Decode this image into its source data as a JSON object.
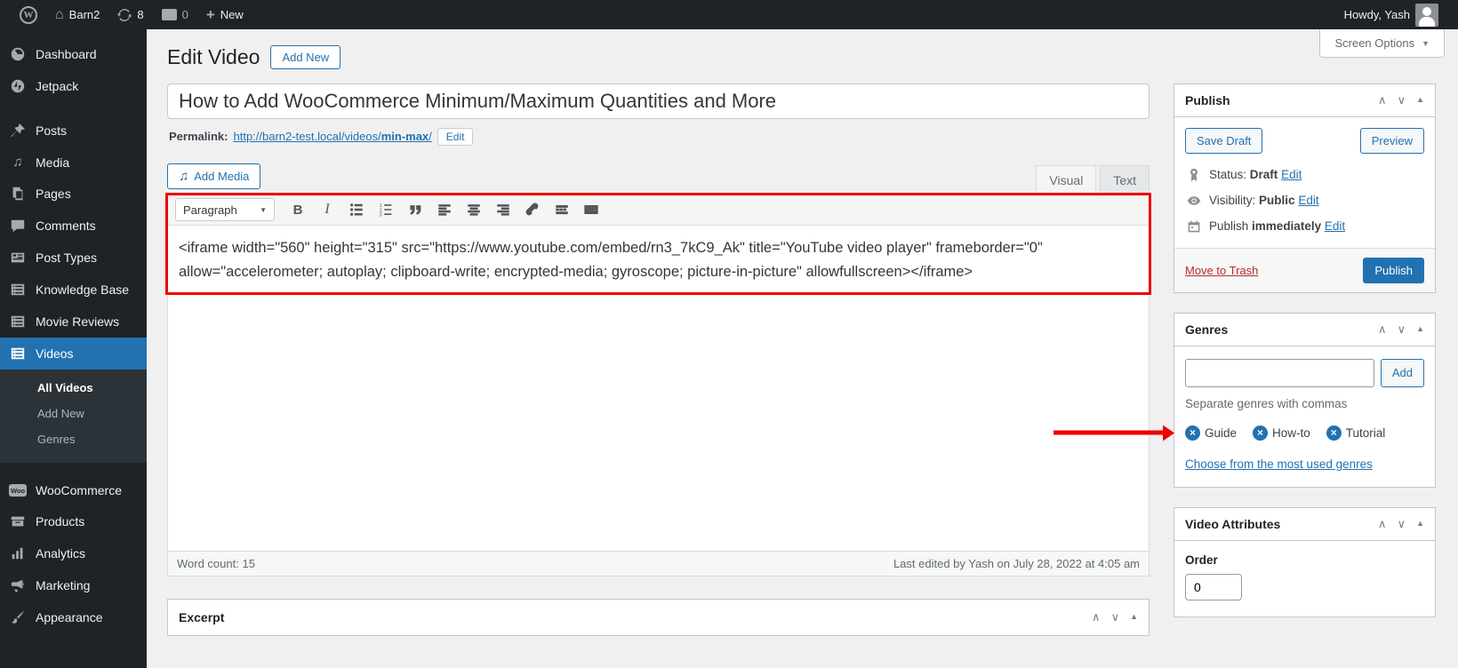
{
  "admin_bar": {
    "site_name": "Barn2",
    "update_count": "8",
    "comment_count": "0",
    "new_label": "New",
    "howdy": "Howdy, Yash"
  },
  "sidebar": {
    "items": [
      {
        "label": "Dashboard"
      },
      {
        "label": "Jetpack"
      },
      {
        "label": "Posts"
      },
      {
        "label": "Media"
      },
      {
        "label": "Pages"
      },
      {
        "label": "Comments"
      },
      {
        "label": "Post Types"
      },
      {
        "label": "Knowledge Base"
      },
      {
        "label": "Movie Reviews"
      },
      {
        "label": "Videos",
        "active": true
      },
      {
        "label": "WooCommerce"
      },
      {
        "label": "Products"
      },
      {
        "label": "Analytics"
      },
      {
        "label": "Marketing"
      },
      {
        "label": "Appearance"
      }
    ],
    "videos_submenu": [
      {
        "label": "All Videos",
        "current": true
      },
      {
        "label": "Add New"
      },
      {
        "label": "Genres"
      }
    ]
  },
  "header": {
    "page_title": "Edit Video",
    "add_new_label": "Add New",
    "screen_options_label": "Screen Options"
  },
  "post": {
    "title_value": "How to Add WooCommerce Minimum/Maximum Quantities and More",
    "permalink_label": "Permalink:",
    "permalink_base": "http://barn2-test.local/videos/",
    "permalink_slug": "min-max",
    "permalink_slash": "/",
    "edit_button": "Edit"
  },
  "editor": {
    "add_media_label": "Add Media",
    "visual_tab": "Visual",
    "text_tab": "Text",
    "format_select": "Paragraph",
    "bold_label": "B",
    "italic_label": "I",
    "content": "<iframe width=\"560\" height=\"315\" src=\"https://www.youtube.com/embed/rn3_7kC9_Ak\" title=\"YouTube video player\" frameborder=\"0\" allow=\"accelerometer; autoplay; clipboard-write; encrypted-media; gyroscope; picture-in-picture\" allowfullscreen></iframe>",
    "word_count_label": "Word count:",
    "word_count_value": "15",
    "last_edited": "Last edited by Yash on July 28, 2022 at 4:05 am"
  },
  "excerpt_panel": {
    "title": "Excerpt"
  },
  "publish_panel": {
    "title": "Publish",
    "save_draft_label": "Save Draft",
    "preview_label": "Preview",
    "status_label": "Status:",
    "status_value": "Draft",
    "visibility_label": "Visibility:",
    "visibility_value": "Public",
    "schedule_label": "Publish",
    "schedule_value": "immediately",
    "edit_link": "Edit",
    "move_to_trash_label": "Move to Trash",
    "publish_button_label": "Publish"
  },
  "genres_panel": {
    "title": "Genres",
    "input_value": "",
    "add_button_label": "Add",
    "hint": "Separate genres with commas",
    "tags": [
      {
        "label": "Guide"
      },
      {
        "label": "How-to"
      },
      {
        "label": "Tutorial"
      }
    ],
    "most_used_link": "Choose from the most used genres"
  },
  "video_attributes_panel": {
    "title": "Video Attributes",
    "order_label": "Order",
    "order_value": "0"
  },
  "icons": {
    "chevron_up": "∧",
    "chevron_down": "∨",
    "collapse_triangle": "▲",
    "dropdown_triangle": "▼",
    "remove_x": "×",
    "media_note": "♫",
    "home": "⌂",
    "plus": "+",
    "wp_w": "W",
    "analytics_bars": "▂▅▇"
  },
  "colors": {
    "accent_blue": "#2271b1",
    "annotation_red": "#ee0000",
    "admin_bar_bg": "#1d2327",
    "active_menu_bg": "#2271b1",
    "trash_red": "#b32d2e"
  }
}
